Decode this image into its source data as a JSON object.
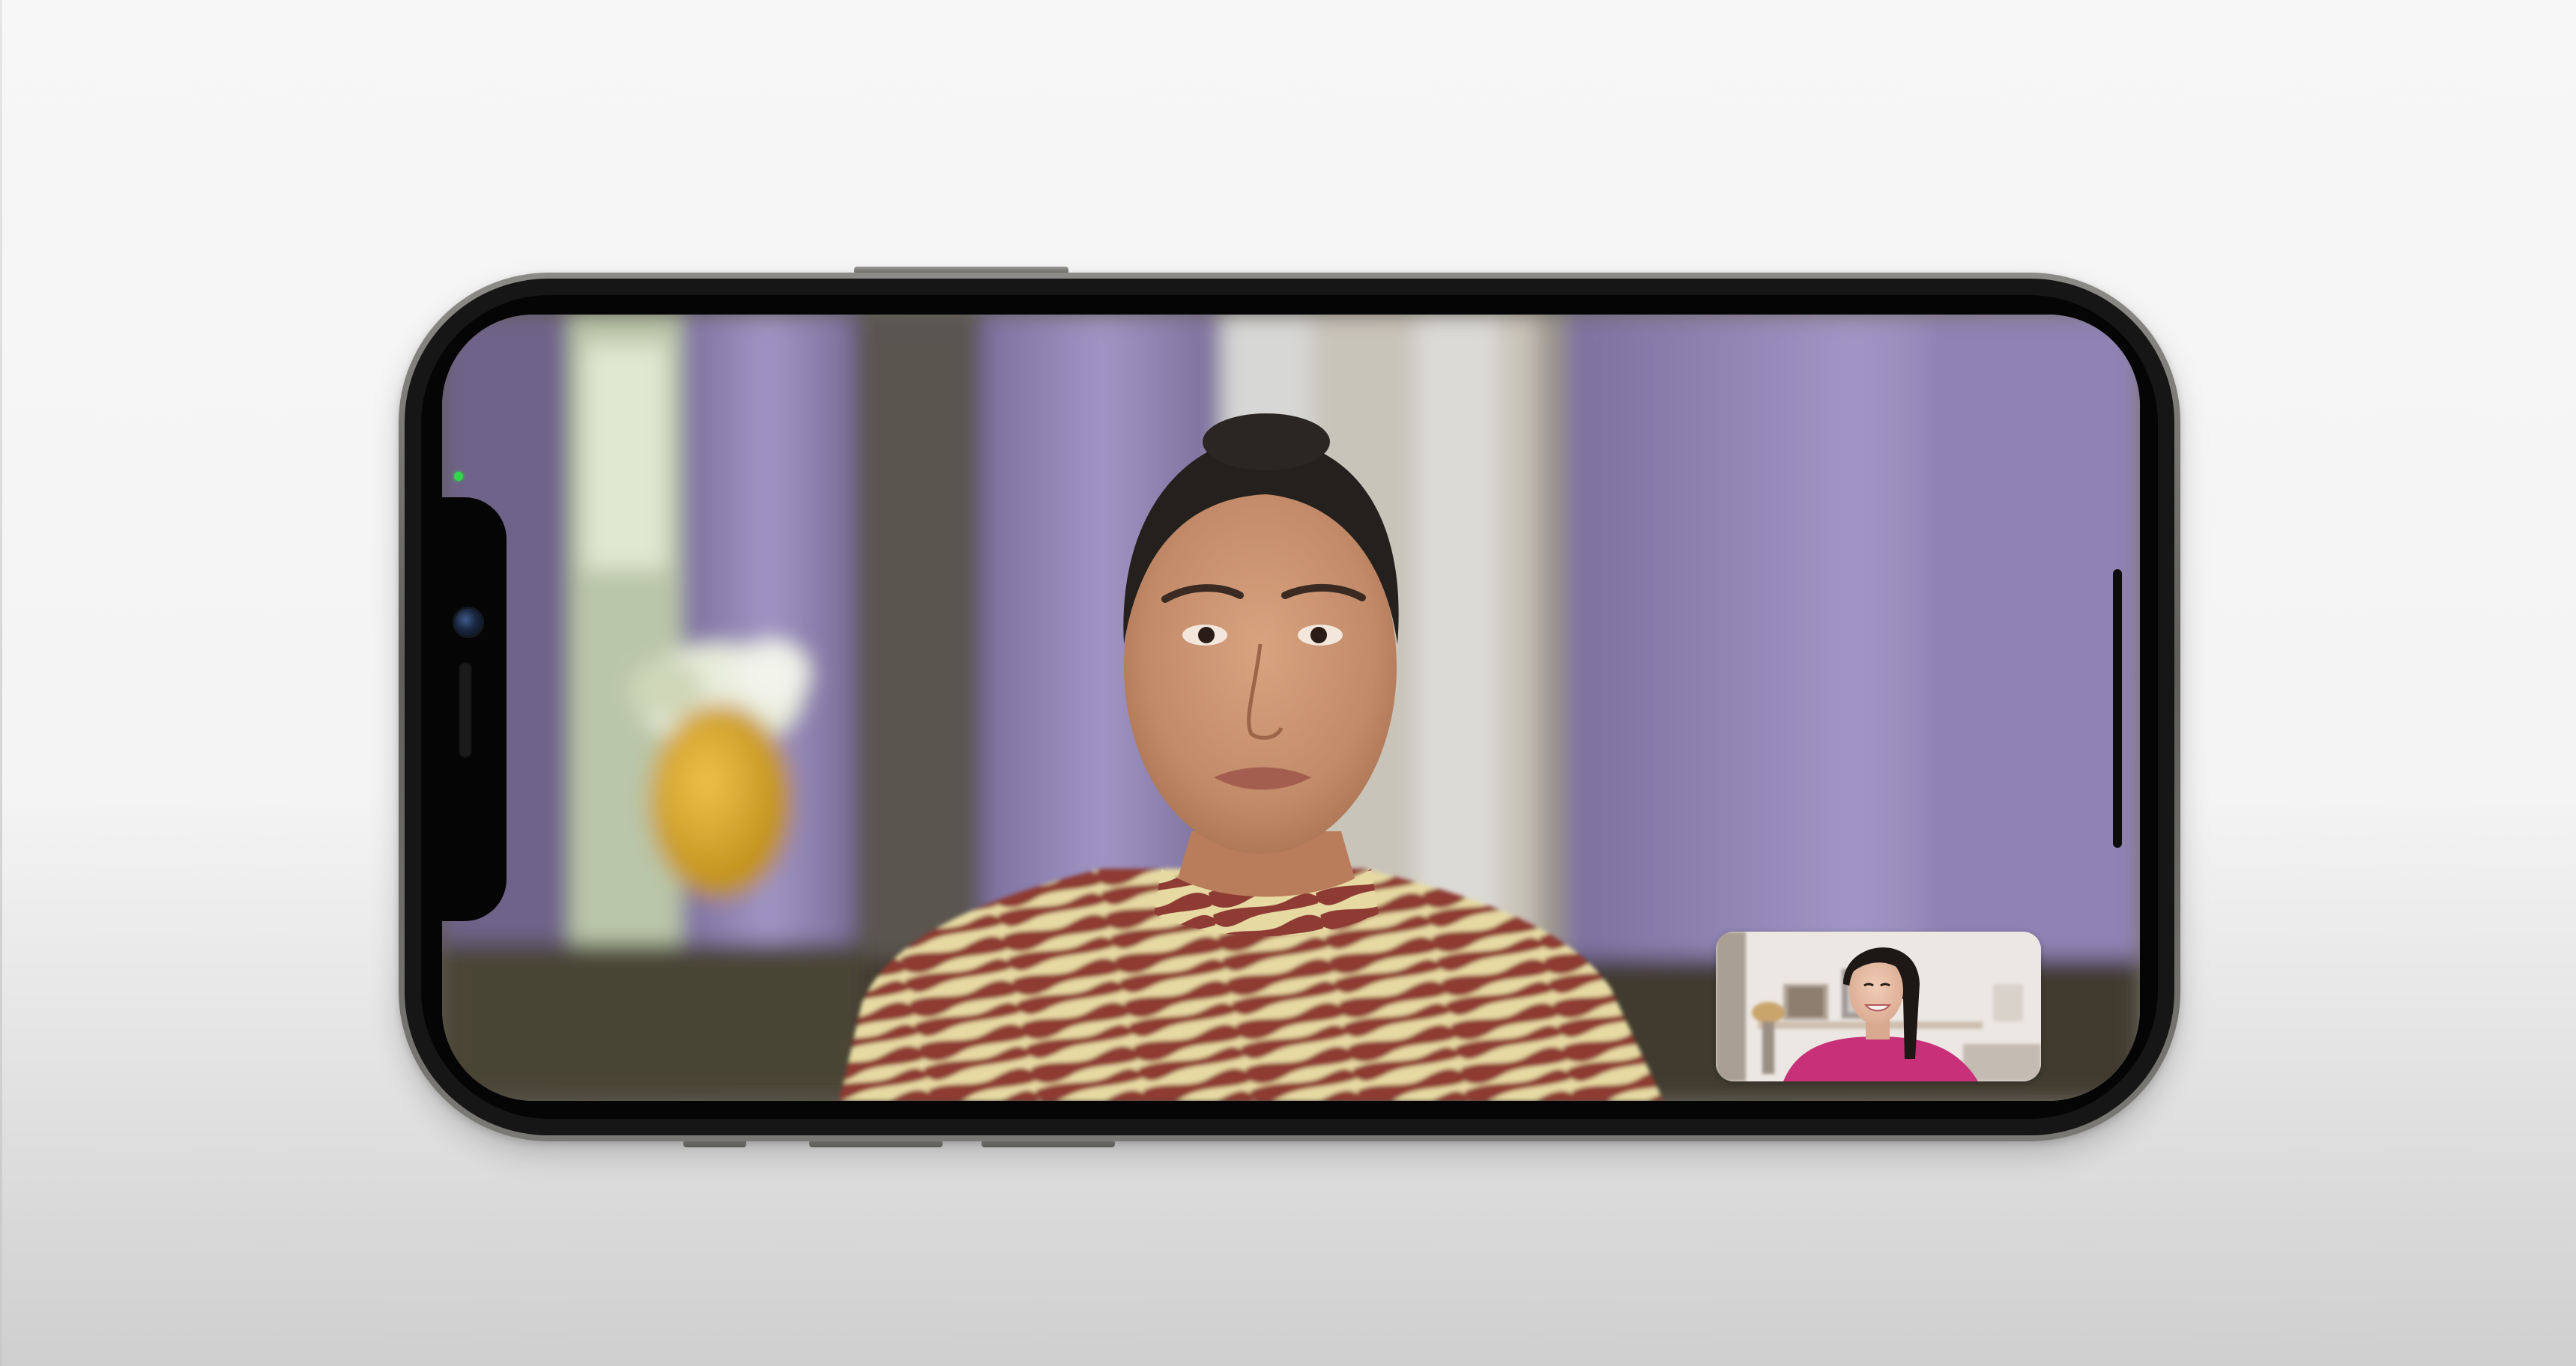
{
  "device": {
    "name": "iPhone",
    "frame_color": "#6b6a66"
  },
  "call": {
    "type": "FaceTime video call",
    "remote_participant": "remote-video-feed",
    "local_preview": "self-view-preview",
    "camera_active_indicator_color": "#33d84a"
  },
  "icons": {
    "camera": "front-camera-icon",
    "speaker": "earpiece-speaker-icon",
    "home_indicator": "home-indicator-bar"
  }
}
